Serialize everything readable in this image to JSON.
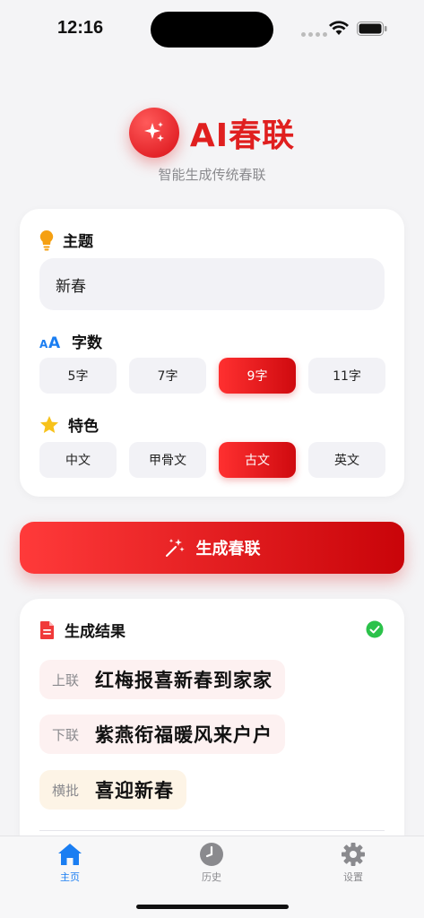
{
  "status": {
    "time": "12:16"
  },
  "header": {
    "title": "AI春联",
    "subtitle": "智能生成传统春联"
  },
  "theme": {
    "label": "主题",
    "value": "新春"
  },
  "char_count": {
    "label": "字数",
    "options": [
      "5字",
      "7字",
      "9字",
      "11字"
    ],
    "selected": "9字"
  },
  "style": {
    "label": "特色",
    "options": [
      "中文",
      "甲骨文",
      "古文",
      "英文"
    ],
    "selected": "古文"
  },
  "generate_button": {
    "label": "生成春联"
  },
  "result": {
    "title": "生成结果",
    "upper": {
      "tag": "上联",
      "text": "红梅报喜新春到家家"
    },
    "lower": {
      "tag": "下联",
      "text": "紫燕衔福暖风来户户"
    },
    "horizontal": {
      "tag": "横批",
      "text": "喜迎新春"
    }
  },
  "tabbar": {
    "items": [
      {
        "label": "主页"
      },
      {
        "label": "历史"
      },
      {
        "label": "设置"
      }
    ],
    "selected": "主页"
  },
  "colors": {
    "accent": "#e01f1f",
    "tab_active": "#1a7ef2",
    "success": "#2bc24a"
  }
}
